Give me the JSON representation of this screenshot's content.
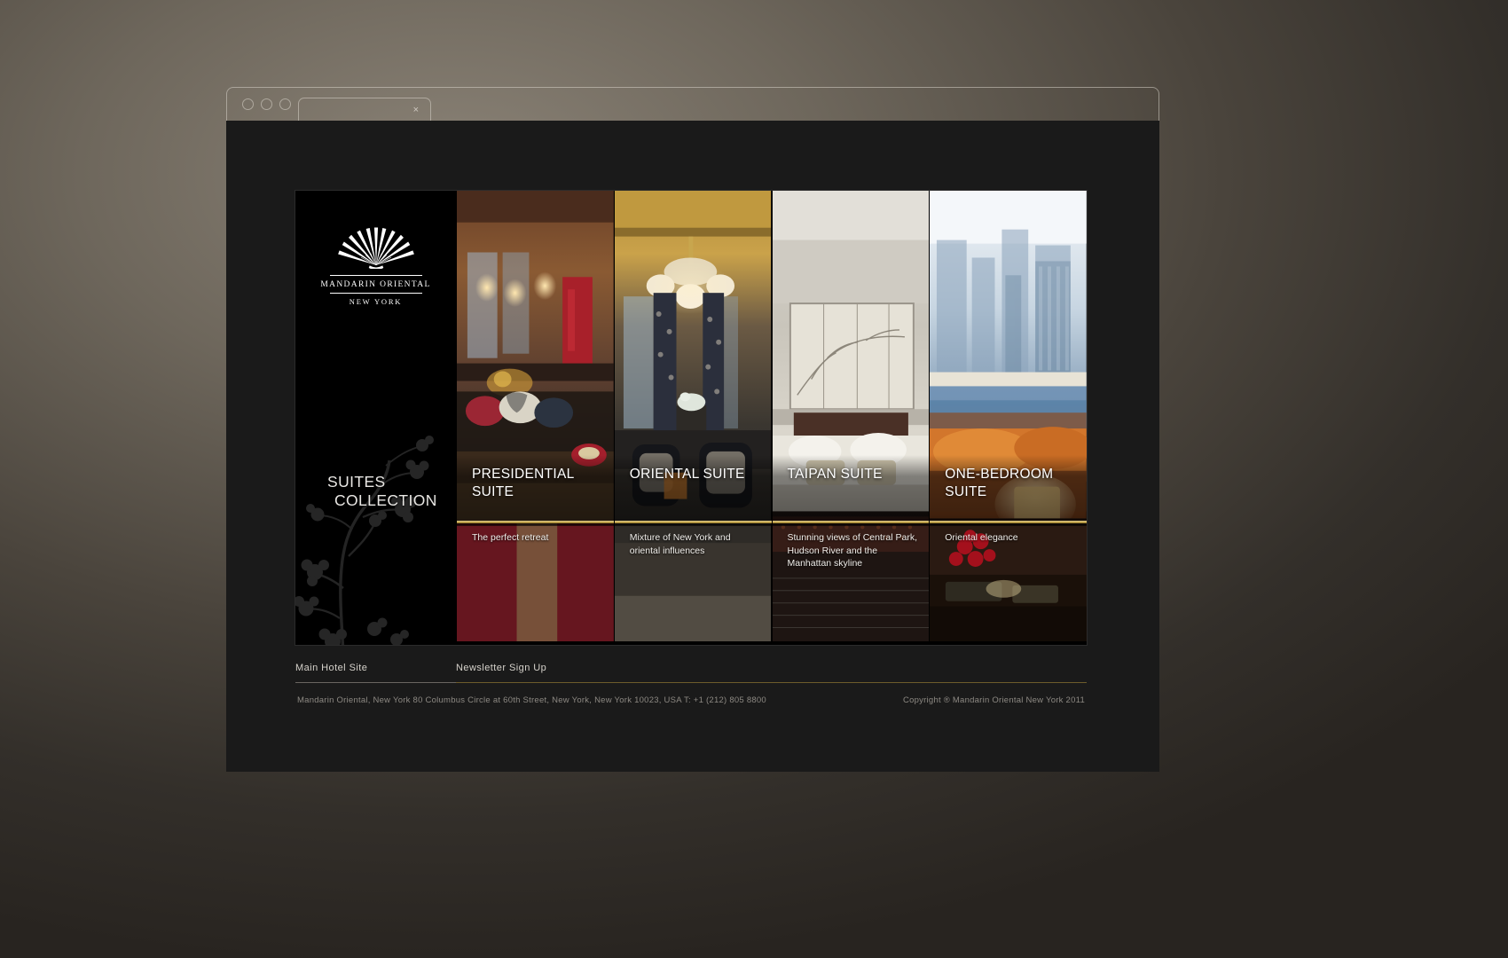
{
  "browser": {
    "tab_close_label": "×",
    "dots": [
      "close-dot",
      "minimize-dot",
      "zoom-dot"
    ]
  },
  "brand": {
    "logo_icon": "mandarin-oriental-fan-icon",
    "name": "MANDARIN ORIENTAL",
    "city": "NEW YORK",
    "heading_line1": "SUITES",
    "heading_line2": "COLLECTION"
  },
  "suites": [
    {
      "title": "PRESIDENTIAL SUITE",
      "title_line1": "PRESIDENTIAL",
      "title_line2": "SUITE",
      "description": "The perfect retreat"
    },
    {
      "title": "ORIENTAL SUITE",
      "title_line1": "ORIENTAL SUITE",
      "title_line2": "",
      "description": "Mixture of New York and oriental influences"
    },
    {
      "title": "TAIPAN SUITE",
      "title_line1": "TAIPAN SUITE",
      "title_line2": "",
      "description": "Stunning views of Central Park, Hudson River and the Manhattan skyline"
    },
    {
      "title": "ONE-BEDROOM SUITE",
      "title_line1": "ONE-BEDROOM",
      "title_line2": "SUITE",
      "description": "Oriental elegance"
    }
  ],
  "footer": {
    "main_site_link": "Main Hotel Site",
    "newsletter_link": "Newsletter Sign Up",
    "address": "Mandarin Oriental, New York 80 Columbus Circle at 60th Street, New York, New York 10023, USA   T: +1 (212) 805 8800",
    "copyright": "Copyright ® Mandarin Oriental New York 2011"
  },
  "colors": {
    "gold": "#c9ab52",
    "page_background": "#1a1a1a",
    "desktop": "#6e675c"
  }
}
